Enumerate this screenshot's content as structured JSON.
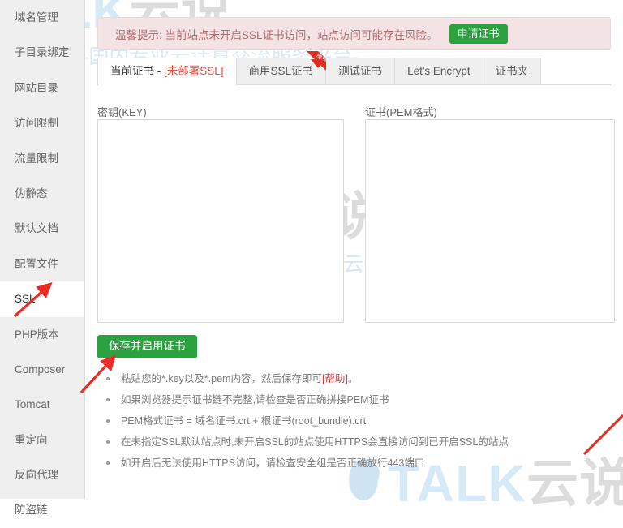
{
  "sidebar": {
    "items": [
      {
        "label": "域名管理",
        "active": false
      },
      {
        "label": "子目录绑定",
        "active": false
      },
      {
        "label": "网站目录",
        "active": false
      },
      {
        "label": "访问限制",
        "active": false
      },
      {
        "label": "流量限制",
        "active": false
      },
      {
        "label": "伪静态",
        "active": false
      },
      {
        "label": "默认文档",
        "active": false
      },
      {
        "label": "配置文件",
        "active": false
      },
      {
        "label": "SSL",
        "active": true
      },
      {
        "label": "PHP版本",
        "active": false
      },
      {
        "label": "Composer",
        "active": false
      },
      {
        "label": "Tomcat",
        "active": false
      },
      {
        "label": "重定向",
        "active": false
      },
      {
        "label": "反向代理",
        "active": false
      },
      {
        "label": "防盗链",
        "active": false
      }
    ]
  },
  "alert": {
    "text": "温馨提示: 当前站点未开启SSL证书访问，站点访问可能存在风险。",
    "button_label": "申请证书",
    "bg_color": "#f4e3e4",
    "text_color": "#b06a6e",
    "button_color": "#2ba23f"
  },
  "tabs": [
    {
      "label_main": "当前证书 - ",
      "label_accent": "[未部署SSL]",
      "active": true,
      "ribbon": ""
    },
    {
      "label_main": "商用SSL证书",
      "label_accent": "",
      "active": false,
      "ribbon": "推荐"
    },
    {
      "label_main": "测试证书",
      "label_accent": "",
      "active": false,
      "ribbon": ""
    },
    {
      "label_main": "Let's Encrypt",
      "label_accent": "",
      "active": false,
      "ribbon": ""
    },
    {
      "label_main": "证书夹",
      "label_accent": "",
      "active": false,
      "ribbon": ""
    }
  ],
  "form": {
    "key_label": "密钥(KEY)",
    "key_value": "",
    "key_placeholder": "",
    "pem_label": "证书(PEM格式)",
    "pem_value": "",
    "pem_placeholder": "",
    "save_label": "保存并启用证书",
    "save_color": "#2ba23f"
  },
  "notes": [
    {
      "text": "粘贴您的*.key以及*.pem内容，然后保存即可",
      "link": "[帮助]",
      "tail": "。"
    },
    {
      "text": "如果浏览器提示证书链不完整,请检查是否正确拼接PEM证书",
      "link": "",
      "tail": ""
    },
    {
      "text": "PEM格式证书 = 域名证书.crt + 根证书(root_bundle).crt",
      "link": "",
      "tail": ""
    },
    {
      "text": "在未指定SSL默认站点时,未开启SSL的站点使用HTTPS会直接访问到已开启SSL的站点",
      "link": "",
      "tail": ""
    },
    {
      "text": "如开启后无法使用HTTPS访问，请检查安全组是否正确放行443端口",
      "link": "",
      "tail": ""
    }
  ],
  "watermark": {
    "brand_talk": "TALK",
    "brand_cn": "云说",
    "subtitle": "-www.idctalk.com-国内专业云计算交流服务平台-",
    "color_blue": "#d6e9f7",
    "color_amber": "#f7e6c9",
    "color_gray": "#dcdcdc"
  },
  "annotations": {
    "arrow_color": "#ee2a24",
    "arrows": [
      {
        "name": "arrow-to-ssl"
      },
      {
        "name": "arrow-to-save-button"
      },
      {
        "name": "arrow-right-edge"
      }
    ]
  }
}
